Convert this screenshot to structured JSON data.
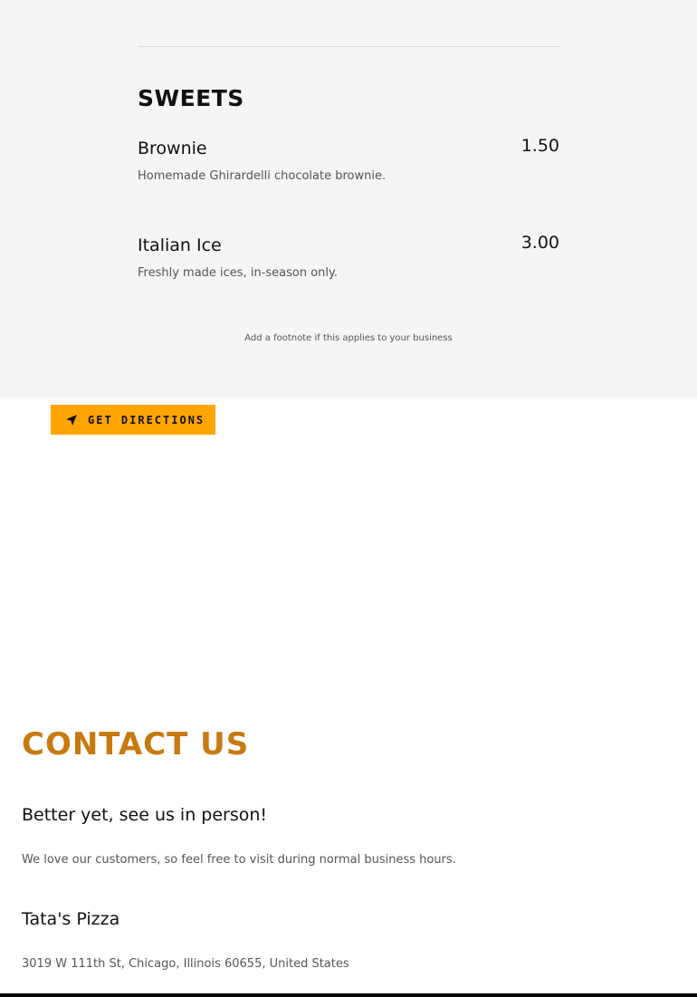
{
  "menu": {
    "category_title": "SWEETS",
    "items": [
      {
        "name": "Brownie",
        "price": "1.50",
        "description": "Homemade Ghirardelli chocolate brownie."
      },
      {
        "name": "Italian Ice",
        "price": "3.00",
        "description": "Freshly made ices, in-season only."
      }
    ],
    "footnote": "Add a footnote if this applies to your business"
  },
  "directions": {
    "label": "GET DIRECTIONS",
    "icon": "navigation-arrow-icon"
  },
  "contact": {
    "title": "CONTACT US",
    "subtitle": "Better yet, see us in person!",
    "text": "We love our customers, so feel free to visit during normal business hours.",
    "business_name": "Tata's Pizza",
    "address": "3019 W 111th St, Chicago, Illinois 60655, United States"
  },
  "colors": {
    "accent_button": "#ffa500",
    "contact_title": "#c87a10",
    "menu_background": "#f5f5f5"
  }
}
